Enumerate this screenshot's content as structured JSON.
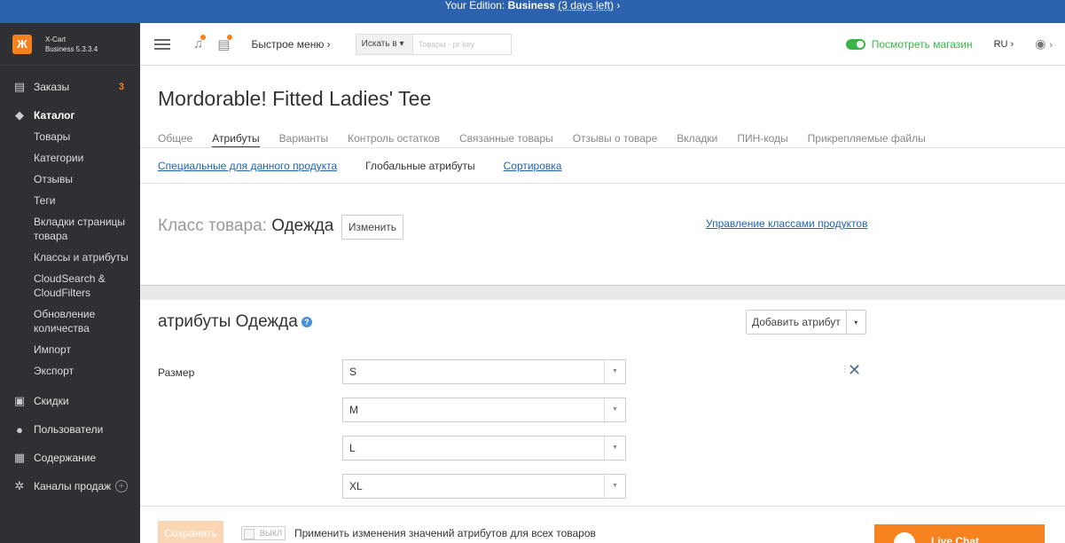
{
  "banner": {
    "prefix": "Your Edition: ",
    "edition": "Business",
    "days": "(3 days left)",
    "arrow": "›"
  },
  "sidebar": {
    "brand_line1": "X-Cart",
    "brand_line2": "Business 5.3.3.4",
    "orders": {
      "label": "Заказы",
      "badge": "3"
    },
    "catalog": {
      "label": "Каталог"
    },
    "catalog_items": [
      "Товары",
      "Категории",
      "Отзывы",
      "Теги",
      "Вкладки страницы товара",
      "Классы и атрибуты",
      "CloudSearch & CloudFilters",
      "Обновление количества",
      "Импорт",
      "Экспорт"
    ],
    "discounts": "Скидки",
    "users": "Пользователи",
    "content": "Содержание",
    "channels": "Каналы продаж",
    "channels_add": "+"
  },
  "header": {
    "quick_menu": "Быстрое меню ›",
    "search_in": "Искать в ▾",
    "search_placeholder": "Товары - pr key",
    "view_store": "Посмотреть магазин",
    "lang": "RU ›",
    "user_arrow": "›"
  },
  "product": {
    "title": "Mordorable! Fitted Ladies' Tee",
    "tabs": [
      "Общее",
      "Атрибуты",
      "Варианты",
      "Контроль остатков",
      "Связанные товары",
      "Отзывы о товаре",
      "Вкладки",
      "ПИН-коды",
      "Прикрепляемые файлы"
    ],
    "active_tab": "Атрибуты",
    "subtabs": {
      "specific": "Специальные для данного продукта",
      "global": "Глобальные атрибуты",
      "sort": "Сортировка"
    },
    "class_label": "Класс товара: ",
    "class_value": "Одежда",
    "change_button": "Изменить",
    "manage_classes": "Управление классами продуктов"
  },
  "attributes": {
    "title": "атрибуты Одежда",
    "help": "?",
    "add_button": "Добавить атрибут",
    "add_dropdown": "▾",
    "row_label": "Размер",
    "options": [
      "S",
      "M",
      "L",
      "XL"
    ]
  },
  "footer": {
    "save": "Сохранить",
    "switch_text": "ВЫКЛ",
    "apply_text": "Применить изменения значений атрибутов для всех товаров",
    "chat": "Live Chat"
  },
  "colors": {
    "brand": "#f5821f",
    "banner": "#2c62ad",
    "sidebar": "#2e3033",
    "link": "#1e63b0",
    "green": "#3bb54a"
  }
}
